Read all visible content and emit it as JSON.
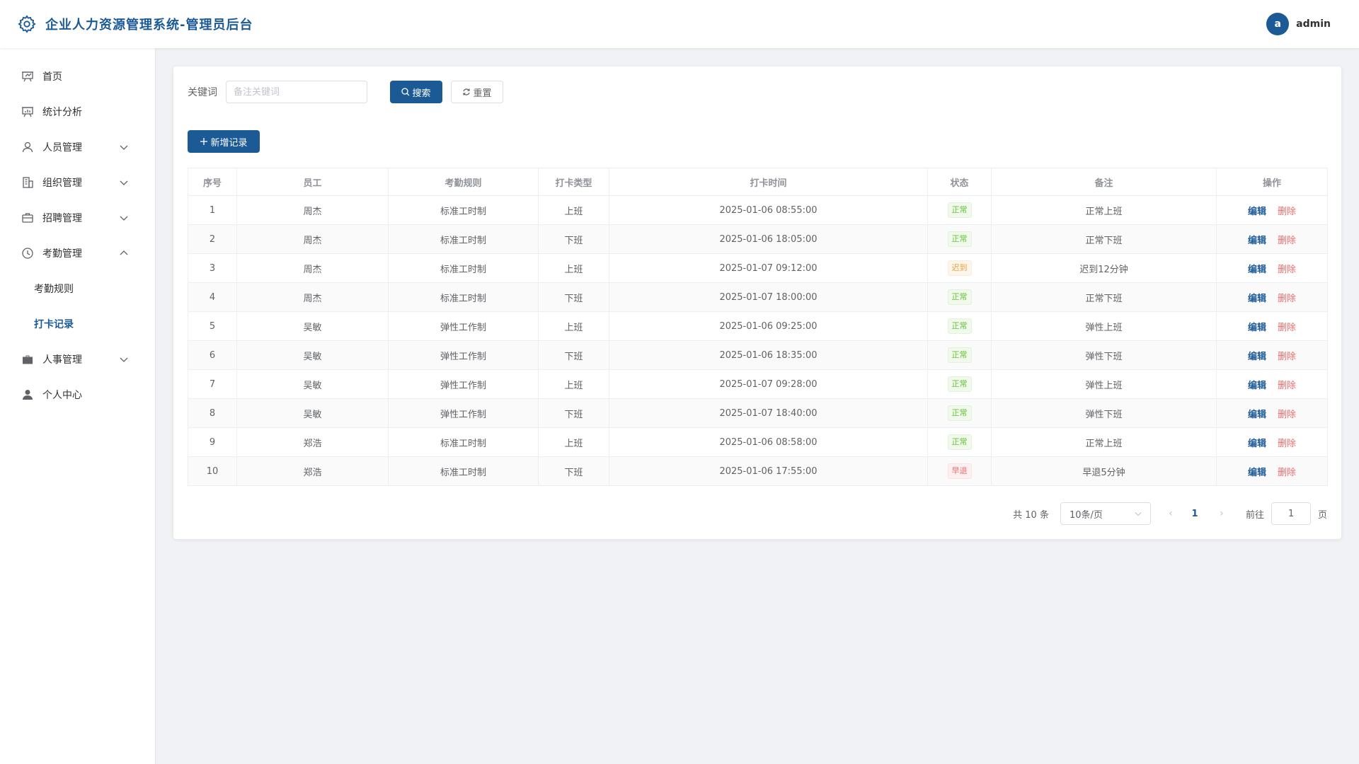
{
  "app": {
    "title": "企业人力资源管理系统-管理员后台"
  },
  "user": {
    "avatar_letter": "a",
    "name": "admin"
  },
  "colors": {
    "brand": "#1c5a96",
    "success": "#67c23a",
    "warning": "#e6a23c",
    "danger": "#f56c6c"
  },
  "sidebar": {
    "items": [
      {
        "label": "首页",
        "icon": "presentation-icon"
      },
      {
        "label": "统计分析",
        "icon": "chart-board-icon"
      },
      {
        "label": "人员管理",
        "icon": "user-icon",
        "expandable": true
      },
      {
        "label": "组织管理",
        "icon": "building-icon",
        "expandable": true
      },
      {
        "label": "招聘管理",
        "icon": "briefcase-icon",
        "expandable": true
      },
      {
        "label": "考勤管理",
        "icon": "clock-icon",
        "expandable": true,
        "expanded": true
      },
      {
        "label": "人事管理",
        "icon": "suitcase-icon",
        "expandable": true
      },
      {
        "label": "个人中心",
        "icon": "person-filled-icon"
      }
    ],
    "sub_items": [
      {
        "label": "考勤规则",
        "active": false
      },
      {
        "label": "打卡记录",
        "active": true
      }
    ]
  },
  "search": {
    "label": "关键词",
    "placeholder": "备注关键词",
    "search_label": "搜索",
    "reset_label": "重置"
  },
  "toolbar": {
    "add_label": "新增记录"
  },
  "table": {
    "columns": [
      "序号",
      "员工",
      "考勤规则",
      "打卡类型",
      "打卡时间",
      "状态",
      "备注",
      "操作"
    ],
    "edit_label": "编辑",
    "delete_label": "删除",
    "rows": [
      {
        "no": "1",
        "employee": "周杰",
        "rule": "标准工时制",
        "type": "上班",
        "time": "2025-01-06 08:55:00",
        "status": "正常",
        "status_kind": "green",
        "remark": "正常上班"
      },
      {
        "no": "2",
        "employee": "周杰",
        "rule": "标准工时制",
        "type": "下班",
        "time": "2025-01-06 18:05:00",
        "status": "正常",
        "status_kind": "green",
        "remark": "正常下班"
      },
      {
        "no": "3",
        "employee": "周杰",
        "rule": "标准工时制",
        "type": "上班",
        "time": "2025-01-07 09:12:00",
        "status": "迟到",
        "status_kind": "orange",
        "remark": "迟到12分钟"
      },
      {
        "no": "4",
        "employee": "周杰",
        "rule": "标准工时制",
        "type": "下班",
        "time": "2025-01-07 18:00:00",
        "status": "正常",
        "status_kind": "green",
        "remark": "正常下班"
      },
      {
        "no": "5",
        "employee": "吴敏",
        "rule": "弹性工作制",
        "type": "上班",
        "time": "2025-01-06 09:25:00",
        "status": "正常",
        "status_kind": "green",
        "remark": "弹性上班"
      },
      {
        "no": "6",
        "employee": "吴敏",
        "rule": "弹性工作制",
        "type": "下班",
        "time": "2025-01-06 18:35:00",
        "status": "正常",
        "status_kind": "green",
        "remark": "弹性下班"
      },
      {
        "no": "7",
        "employee": "吴敏",
        "rule": "弹性工作制",
        "type": "上班",
        "time": "2025-01-07 09:28:00",
        "status": "正常",
        "status_kind": "green",
        "remark": "弹性上班"
      },
      {
        "no": "8",
        "employee": "吴敏",
        "rule": "弹性工作制",
        "type": "下班",
        "time": "2025-01-07 18:40:00",
        "status": "正常",
        "status_kind": "green",
        "remark": "弹性下班"
      },
      {
        "no": "9",
        "employee": "郑浩",
        "rule": "标准工时制",
        "type": "上班",
        "time": "2025-01-06 08:58:00",
        "status": "正常",
        "status_kind": "green",
        "remark": "正常上班"
      },
      {
        "no": "10",
        "employee": "郑浩",
        "rule": "标准工时制",
        "type": "下班",
        "time": "2025-01-06 17:55:00",
        "status": "早退",
        "status_kind": "red",
        "remark": "早退5分钟"
      }
    ]
  },
  "pagination": {
    "total_text": "共 10 条",
    "page_size": "10条/页",
    "current_page": "1",
    "goto_label": "前往",
    "goto_value": "1",
    "page_suffix": "页"
  }
}
